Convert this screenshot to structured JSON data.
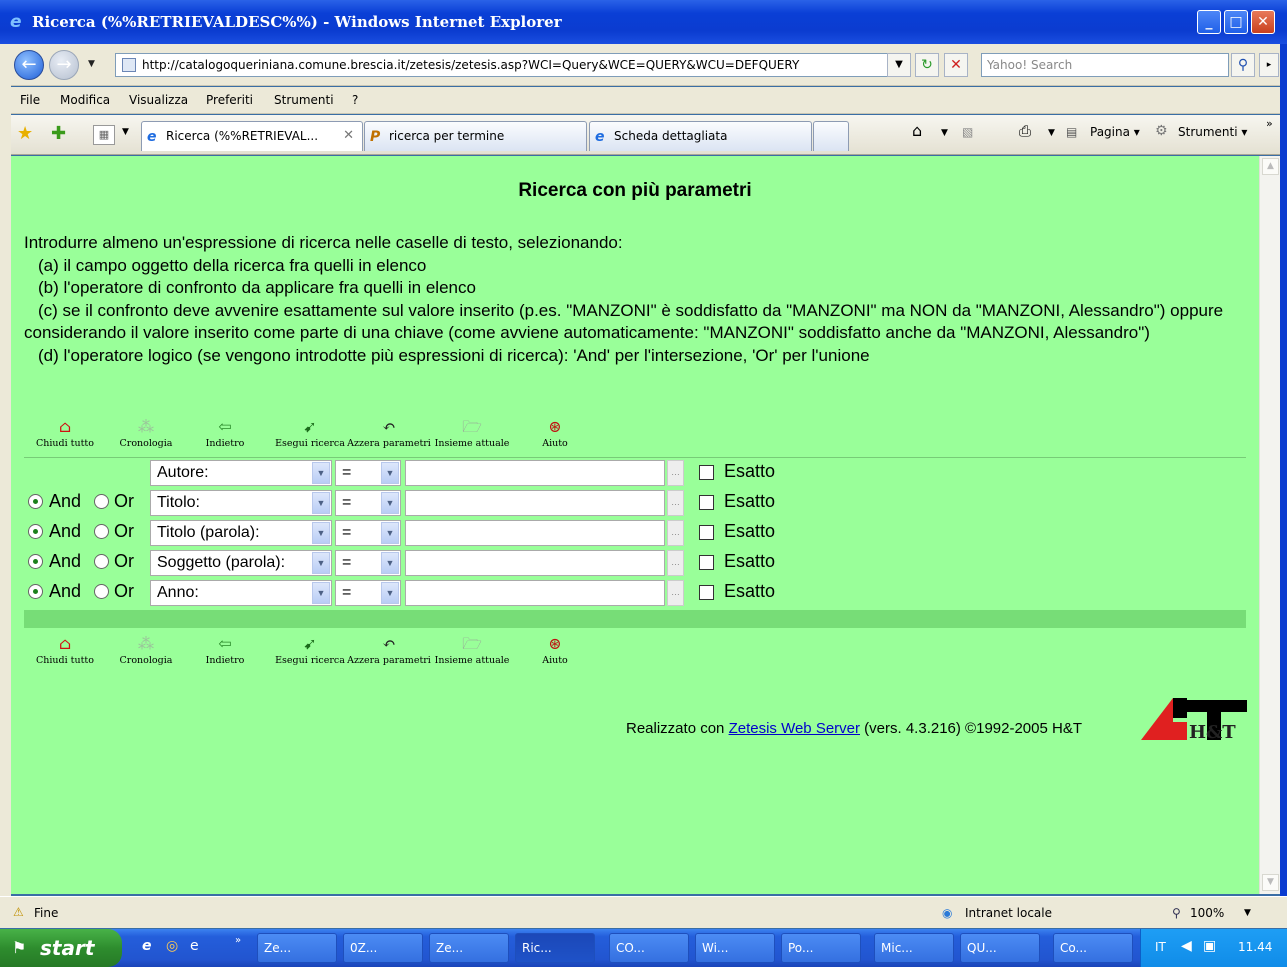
{
  "window": {
    "title": "Ricerca (%%RETRIEVALDESC%%) - Windows Internet Explorer"
  },
  "address": {
    "url": "http://catalogoqueriniana.comune.brescia.it/zetesis/zetesis.asp?WCI=Query&WCE=QUERY&WCU=DEFQUERY",
    "search_placeholder": "Yahoo! Search"
  },
  "menu": [
    "File",
    "Modifica",
    "Visualizza",
    "Preferiti",
    "Strumenti",
    "?"
  ],
  "tabs": [
    {
      "label": "Ricerca (%%RETRIEVAL..."
    },
    {
      "label": "ricerca per termine"
    },
    {
      "label": "Scheda dettagliata"
    }
  ],
  "commands": {
    "page": "Pagina",
    "tools": "Strumenti"
  },
  "page": {
    "heading": "Ricerca con più parametri",
    "intro": [
      "Introdurre almeno un'espressione di ricerca nelle caselle di testo, selezionando:",
      "(a) il campo oggetto della ricerca fra quelli in elenco",
      "(b) l'operatore di confronto da applicare fra quelli in elenco",
      "(c) se il confronto deve avvenire esattamente sul valore inserito (p.es. \"MANZONI\" è soddisfatto da \"MANZONI\" ma NON da \"MANZONI, Alessandro\") oppure considerando il valore inserito come parte di una chiave (come avviene automaticamente: \"MANZONI\" soddisfatto anche da \"MANZONI, Alessandro\")",
      "(d) l'operatore logico (se vengono introdotte più espressioni di ricerca): 'And' per l'intersezione, 'Or' per l'unione"
    ],
    "toolbar": [
      "Chiudi tutto",
      "Cronologia",
      "Indietro",
      "Esegui ricerca",
      "Azzera parametri",
      "Insieme attuale",
      "Aiuto"
    ],
    "and_label": "And",
    "or_label": "Or",
    "exact_label": "Esatto",
    "operator": "=",
    "fields": [
      "Autore:",
      "Titolo:",
      "Titolo (parola):",
      "Soggetto (parola):",
      "Anno:"
    ],
    "footer": {
      "prefix": "Realizzato con",
      "link": "Zetesis Web Server",
      "suffix": "(vers. 4.3.216) ©1992-2005 H&T"
    },
    "logo_text": "H&T"
  },
  "status": {
    "left": "Fine",
    "zone": "Intranet locale",
    "zoom": "100%"
  },
  "taskbar": {
    "start": "start",
    "buttons": [
      "Ze...",
      "0Z...",
      "Ze...",
      "Ric...",
      "CO...",
      "Wi...",
      "Po...",
      "Mic...",
      "QU...",
      "Co..."
    ],
    "lang": "IT",
    "clock": "11.44"
  }
}
